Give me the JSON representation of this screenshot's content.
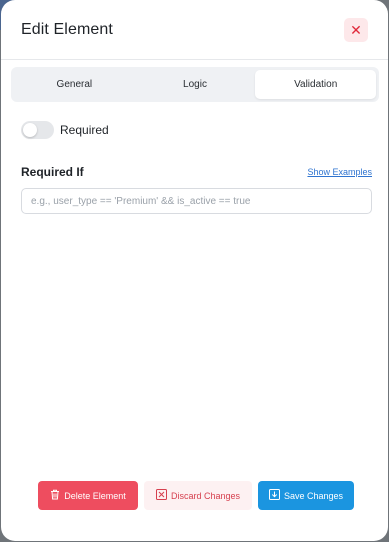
{
  "modal": {
    "title": "Edit Element",
    "close_icon": "close-icon"
  },
  "tabs": [
    {
      "label": "General",
      "active": false
    },
    {
      "label": "Logic",
      "active": false
    },
    {
      "label": "Validation",
      "active": true
    }
  ],
  "validation": {
    "required_label": "Required",
    "required_on": false,
    "required_if_label": "Required If",
    "show_examples_label": "Show Examples",
    "condition_value": "",
    "condition_placeholder": "e.g., user_type == 'Premium' && is_active == true"
  },
  "footer": {
    "delete_label": "Delete Element",
    "discard_label": "Discard Changes",
    "save_label": "Save Changes"
  },
  "colors": {
    "danger": "#ee4d5f",
    "primary": "#1b95e0",
    "link": "#2f74d0"
  }
}
